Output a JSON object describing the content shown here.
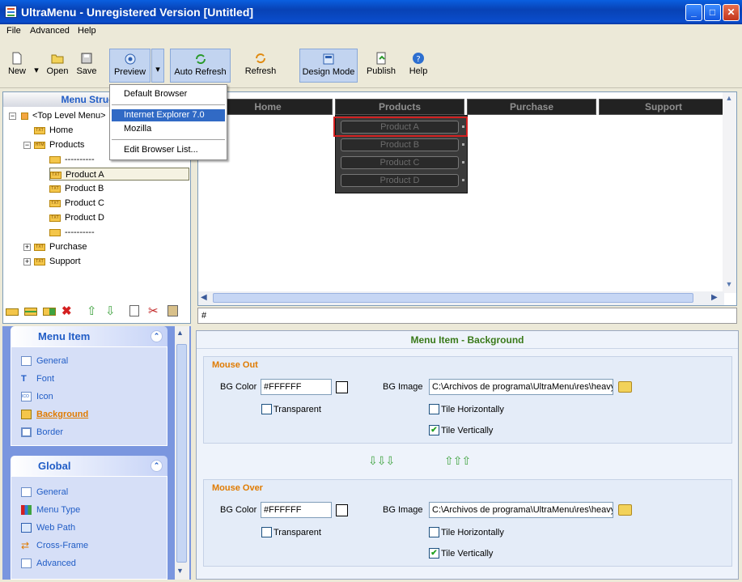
{
  "window": {
    "title": "UltraMenu - Unregistered Version [Untitled]"
  },
  "menubar": {
    "items": [
      "File",
      "Advanced",
      "Help"
    ]
  },
  "toolbar": {
    "new": "New",
    "open": "Open",
    "save": "Save",
    "preview": "Preview",
    "auto_refresh": "Auto Refresh",
    "refresh": "Refresh",
    "design_mode": "Design Mode",
    "publish": "Publish",
    "help": "Help"
  },
  "preview_dropdown": {
    "items": [
      "Default Browser",
      "Internet Explorer 7.0",
      "Mozilla",
      "Edit Browser List..."
    ],
    "selected": "Internet Explorer 7.0"
  },
  "structure": {
    "header": "Menu Structure",
    "root": "<Top Level Menu>",
    "items": [
      "Home",
      "Products",
      "----------",
      "Product A",
      "Product B",
      "Product C",
      "Product D",
      "----------",
      "Purchase",
      "Support"
    ],
    "selected": "Product A"
  },
  "preview": {
    "tabs": [
      "Home",
      "Products",
      "Purchase",
      "Support"
    ],
    "submenu": [
      "Product A",
      "Product B",
      "Product C",
      "Product D"
    ],
    "status": "#"
  },
  "left_pane": {
    "menu_item_header": "Menu Item",
    "menu_item_links": [
      "General",
      "Font",
      "Icon",
      "Background",
      "Border"
    ],
    "active_link": "Background",
    "global_header": "Global",
    "global_links": [
      "General",
      "Menu Type",
      "Web Path",
      "Cross-Frame",
      "Advanced"
    ]
  },
  "props": {
    "title": "Menu Item - Background",
    "mouse_out": {
      "title": "Mouse Out",
      "bg_color_label": "BG Color",
      "bg_color": "#FFFFFF",
      "transparent_label": "Transparent",
      "bg_image_label": "BG Image",
      "bg_image": "C:\\Archivos de programa\\UltraMenu\\res\\heavy",
      "tile_h_label": "Tile Horizontally",
      "tile_v_label": "Tile Vertically",
      "transparent": false,
      "tile_h": false,
      "tile_v": true
    },
    "mouse_over": {
      "title": "Mouse Over",
      "bg_color_label": "BG Color",
      "bg_color": "#FFFFFF",
      "transparent_label": "Transparent",
      "bg_image_label": "BG Image",
      "bg_image": "C:\\Archivos de programa\\UltraMenu\\res\\heavy",
      "tile_h_label": "Tile Horizontally",
      "tile_v_label": "Tile Vertically",
      "transparent": false,
      "tile_h": false,
      "tile_v": true
    }
  },
  "colors": {
    "accent": "#215dc6",
    "group_title": "#e07b00",
    "props_title": "#3a7a1a",
    "selection": "#316ac5",
    "highlight_border": "#d42020"
  }
}
